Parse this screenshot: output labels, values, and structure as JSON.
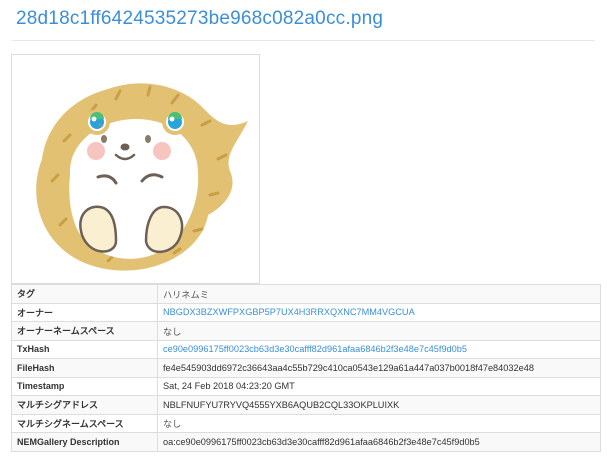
{
  "page": {
    "title": "28d18c1ff6424535273be968c082a0cc.png"
  },
  "colors": {
    "link": "#3b8fd6",
    "hedgehog_spines": "#e2c173",
    "hedgehog_body": "#ffffff",
    "belly": "#fbefd2",
    "cheek": "#f7c5bf"
  },
  "image": {
    "description_icon": "hedgehog-illustration-icon"
  },
  "details": {
    "rows": [
      {
        "key": "タグ",
        "value": "ハリネムミ"
      },
      {
        "key": "オーナー",
        "value": "NBGDX3BZXWFPXGBP5P7UX4H3RRXQXNC7MM4VGCUA"
      },
      {
        "key": "オーナーネームスペース",
        "value": "なし"
      },
      {
        "key": "TxHash",
        "value": "ce90e0996175ff0023cb63d3e30cafff82d961afaa6846b2f3e48e7c45f9d0b5"
      },
      {
        "key": "FileHash",
        "value": "fe4e545903dd6972c36643aa4c55b729c410ca0543e129a61a447a037b0018f47e84032e48"
      },
      {
        "key": "Timestamp",
        "value": "Sat, 24 Feb 2018 04:23:20 GMT"
      },
      {
        "key": "マルチシグアドレス",
        "value": "NBLFNUFYU7RYVQ4555YXB6AQUB2CQL33OKPLUIXK"
      },
      {
        "key": "マルチシグネームスペース",
        "value": "なし"
      },
      {
        "key": "NEMGallery Description",
        "value": "oa:ce90e0996175ff0023cb63d3e30cafff82d961afaa6846b2f3e48e7c45f9d0b5"
      }
    ]
  }
}
